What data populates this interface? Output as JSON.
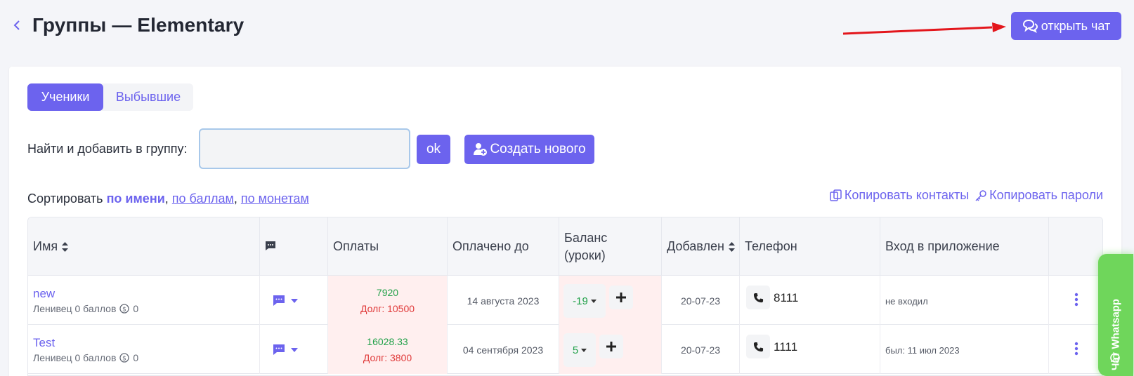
{
  "header": {
    "title": "Группы — Elementary",
    "open_chat_label": "открыть чат"
  },
  "tabs": [
    {
      "label": "Ученики",
      "active": true
    },
    {
      "label": "Выбывшие",
      "active": false
    }
  ],
  "search": {
    "label": "Найти и добавить в группу:",
    "value": "",
    "ok_label": "ok",
    "create_label": "Создать нового"
  },
  "sort": {
    "prefix": "Сортировать",
    "current": "по имени",
    "sep1": ",",
    "option2": "по баллам",
    "sep2": ",",
    "option3": "по монетам"
  },
  "copy": {
    "contacts": "Копировать контакты",
    "passwords": "Копировать пароли"
  },
  "table": {
    "headers": {
      "name": "Имя",
      "payments": "Оплаты",
      "paid_until": "Оплачено до",
      "balance_line1": "Баланс",
      "balance_line2": "(уроки)",
      "added": "Добавлен",
      "phone": "Телефон",
      "login": "Вход в приложение"
    },
    "rows": [
      {
        "name": "new",
        "sub": "Ленивец 0 баллов",
        "coins": "0",
        "payment": "7920",
        "debt": "Долг: 10500",
        "paid_until": "14 августа 2023",
        "balance": "-19",
        "added": "20-07-23",
        "phone": "8111",
        "login": "не входил"
      },
      {
        "name": "Test",
        "sub": "Ленивец 0 баллов",
        "coins": "0",
        "payment": "16028.33",
        "debt": "Долг: 3800",
        "paid_until": "04 сентября 2023",
        "balance": "5",
        "added": "20-07-23",
        "phone": "1111",
        "login": "был: 11 июл 2023"
      }
    ]
  },
  "whatsapp": {
    "label": "Чат Whatsapp"
  },
  "colors": {
    "accent": "#6c63ee",
    "positive": "#22a14a",
    "negative": "#e03a3a",
    "debt_bg": "#ffefef",
    "whatsapp": "#6fd65b",
    "annotation_arrow": "#e3161c"
  },
  "icons": [
    "chevron-left-icon",
    "chat-bubbles-icon",
    "add-user-icon",
    "copy-icon",
    "key-icon",
    "sort-icon",
    "message-icon",
    "caret-down-icon",
    "coin-icon",
    "plus-icon",
    "phone-icon",
    "kebab-icon",
    "whatsapp-icon"
  ]
}
